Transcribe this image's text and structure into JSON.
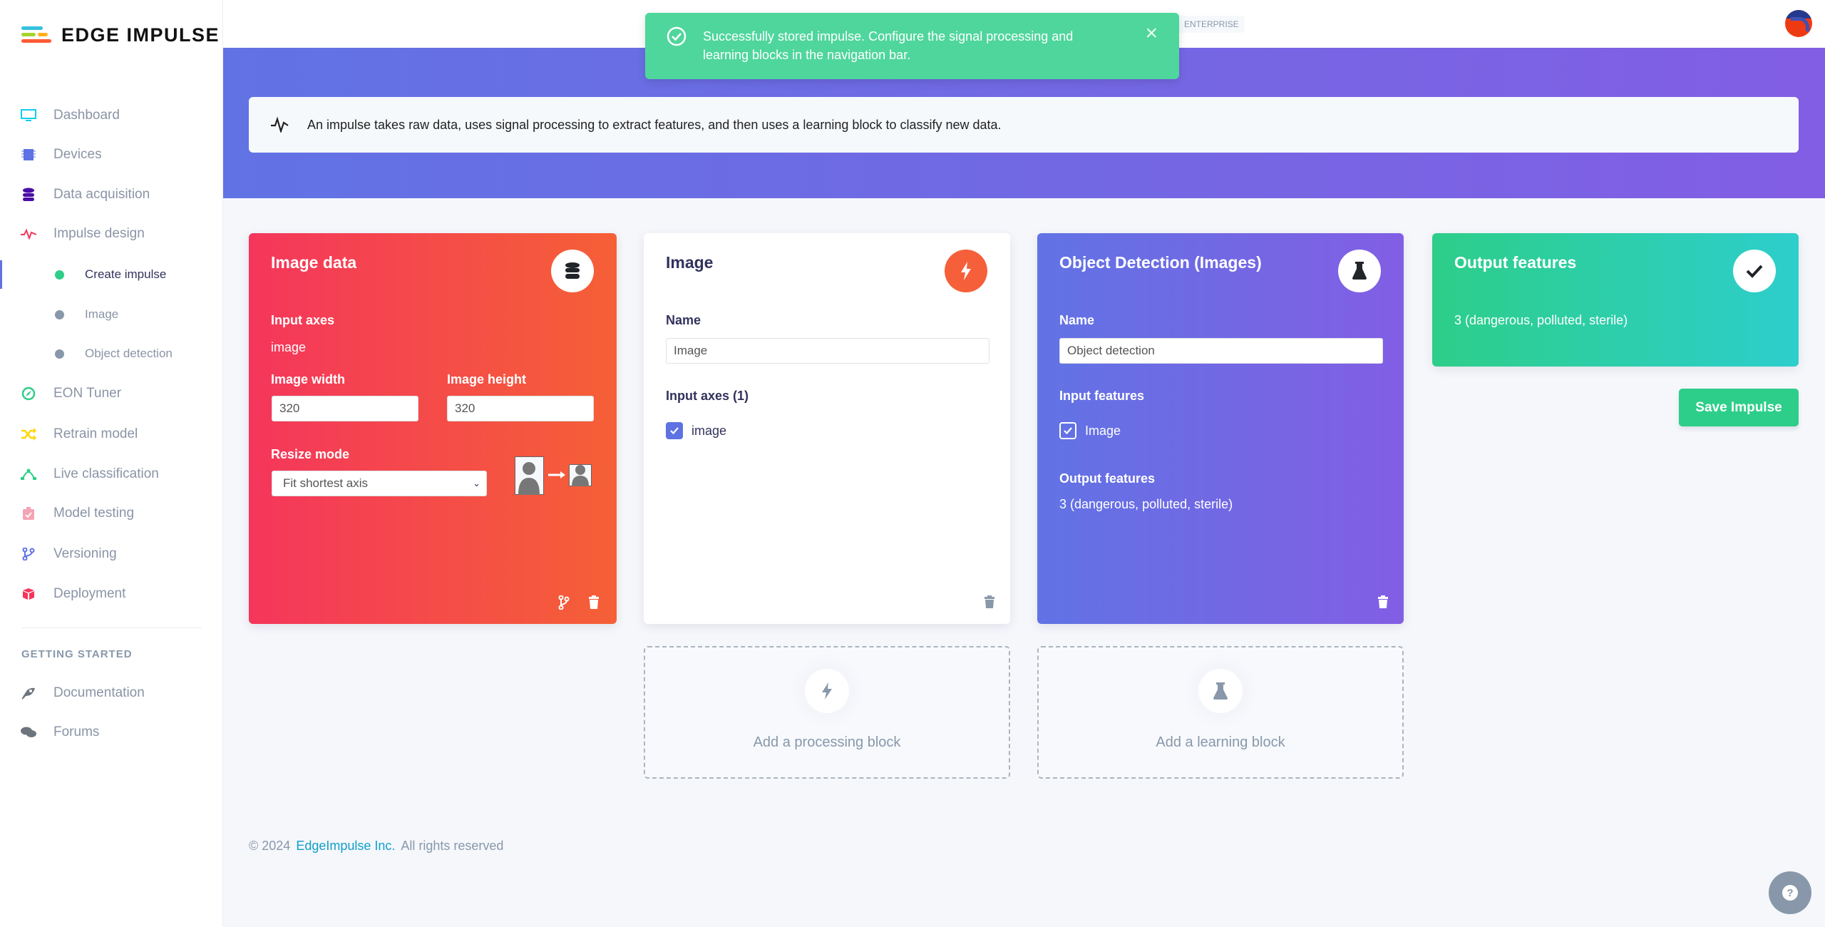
{
  "brand": {
    "name": "EDGE IMPULSE"
  },
  "sidebar": {
    "items": [
      {
        "label": "Dashboard",
        "icon": "monitor-icon",
        "color": "#11cdef"
      },
      {
        "label": "Devices",
        "icon": "chip-icon",
        "color": "#5e72e4"
      },
      {
        "label": "Data acquisition",
        "icon": "database-icon",
        "color": "#4a0ea6"
      },
      {
        "label": "Impulse design",
        "icon": "pulse-icon",
        "color": "#f5365c"
      },
      {
        "label": "Create impulse",
        "sub": true,
        "active": true
      },
      {
        "label": "Image",
        "sub": true
      },
      {
        "label": "Object detection",
        "sub": true
      },
      {
        "label": "EON Tuner",
        "icon": "compass-icon",
        "color": "#2dce89"
      },
      {
        "label": "Retrain model",
        "icon": "shuffle-icon",
        "color": "#ffd600"
      },
      {
        "label": "Live classification",
        "icon": "bezier-icon",
        "color": "#2dce89"
      },
      {
        "label": "Model testing",
        "icon": "clipboard-check-icon",
        "color": "#f3a4b5"
      },
      {
        "label": "Versioning",
        "icon": "branch-icon",
        "color": "#5e72e4"
      },
      {
        "label": "Deployment",
        "icon": "cube-icon",
        "color": "#f5365c"
      }
    ],
    "section_title": "GETTING STARTED",
    "extra": [
      {
        "label": "Documentation",
        "icon": "rocket-icon"
      },
      {
        "label": "Forums",
        "icon": "comments-icon"
      }
    ]
  },
  "header": {
    "badge": "ENTERPRISE"
  },
  "toast": {
    "message": "Successfully stored impulse. Configure the signal processing and learning blocks in the navigation bar.",
    "close": "×"
  },
  "info": {
    "text": "An impulse takes raw data, uses signal processing to extract features, and then uses a learning block to classify new data."
  },
  "input_block": {
    "title": "Image data",
    "input_axes_label": "Input axes",
    "input_axes_value": "image",
    "width_label": "Image width",
    "width_value": "320",
    "height_label": "Image height",
    "height_value": "320",
    "resize_label": "Resize mode",
    "resize_value": "Fit shortest axis"
  },
  "processing_block": {
    "title": "Image",
    "name_label": "Name",
    "name_value": "Image",
    "input_axes_label": "Input axes (1)",
    "axes": [
      {
        "label": "image",
        "checked": true
      }
    ]
  },
  "learning_block": {
    "title": "Object Detection (Images)",
    "name_label": "Name",
    "name_value": "Object detection",
    "input_features_label": "Input features",
    "features": [
      {
        "label": "Image",
        "checked": true
      }
    ],
    "output_label": "Output features",
    "output_value": "3 (dangerous, polluted, sterile)"
  },
  "output_block": {
    "title": "Output features",
    "value": "3 (dangerous, polluted, sterile)"
  },
  "save_label": "Save Impulse",
  "add_processing": "Add a processing block",
  "add_learning": "Add a learning block",
  "footer": {
    "copyright": "© 2024",
    "company": "EdgeImpulse Inc.",
    "rights": "All rights reserved"
  },
  "colors": {
    "accent": "#5e72e4",
    "success": "#2dce89",
    "toast": "#4fd69c"
  }
}
